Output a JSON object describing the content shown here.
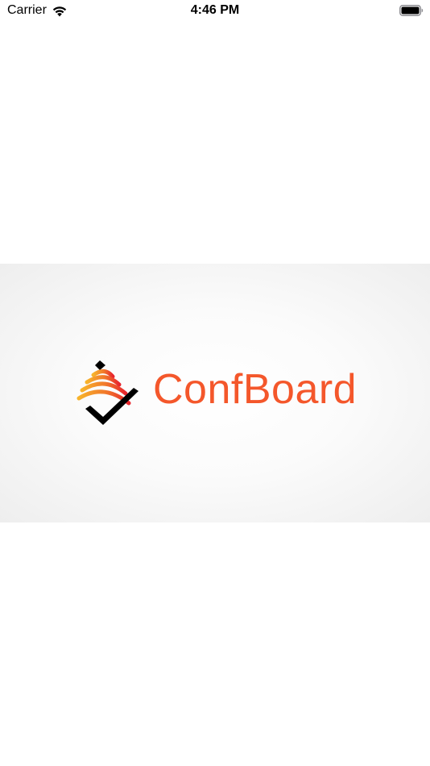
{
  "status_bar": {
    "carrier": "Carrier",
    "time": "4:46 PM",
    "icons": {
      "wifi": "wifi-icon",
      "battery": "battery-icon"
    }
  },
  "splash": {
    "brand_name": "ConfBoard",
    "logo": "confboard-logo-icon",
    "colors": {
      "brand_orange": "#f4572b",
      "gradient_yellow": "#f7b32b",
      "gradient_red": "#e8262d",
      "mark_black": "#000000"
    }
  }
}
